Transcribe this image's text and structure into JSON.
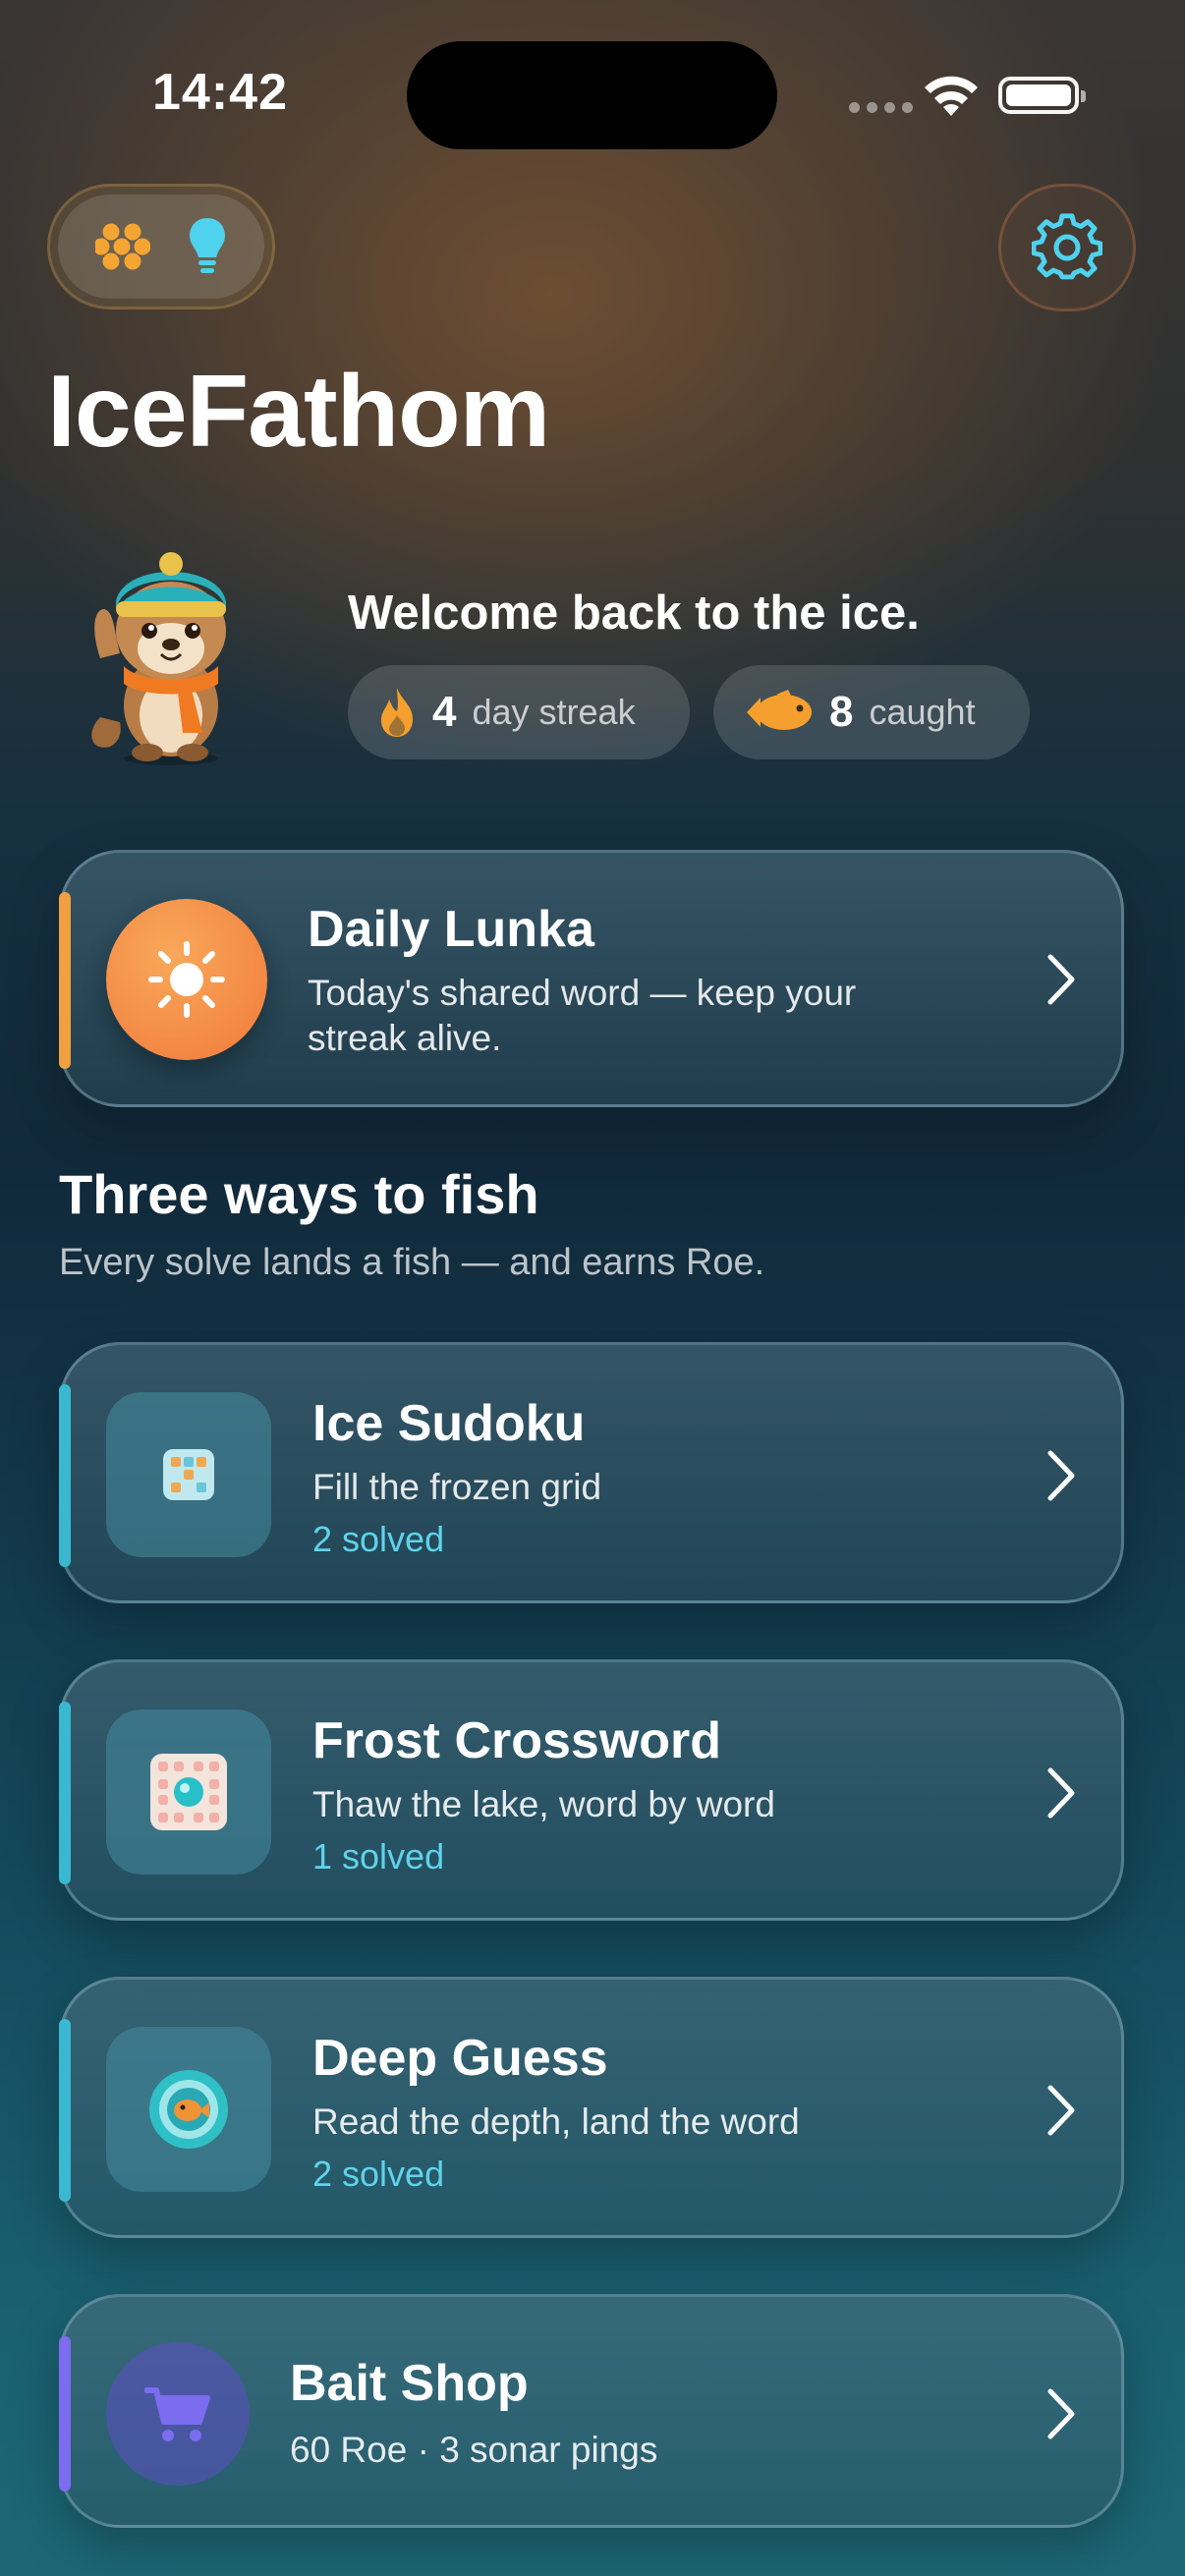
{
  "status_bar": {
    "time": "14:42"
  },
  "header": {
    "app_title": "IceFathom"
  },
  "welcome": {
    "message": "Welcome back to the ice.",
    "streak": {
      "value": "4",
      "label": "day streak"
    },
    "caught": {
      "value": "8",
      "label": "caught"
    }
  },
  "daily": {
    "title": "Daily Lunka",
    "subtitle_line1": "Today's shared word — keep your",
    "subtitle_line2": "streak alive.",
    "accent_color": "#f0a040"
  },
  "section": {
    "title": "Three ways to fish",
    "subtitle": "Every solve lands a fish — and earns Roe."
  },
  "modes": [
    {
      "title": "Ice Sudoku",
      "subtitle": "Fill the frozen grid",
      "solved": "2 solved",
      "icon": "sudoku-cube-icon"
    },
    {
      "title": "Frost Crossword",
      "subtitle": "Thaw the lake, word by word",
      "solved": "1 solved",
      "icon": "crossword-board-icon"
    },
    {
      "title": "Deep Guess",
      "subtitle": "Read the depth, land the word",
      "solved": "2 solved",
      "icon": "sonar-fish-icon"
    }
  ],
  "shop": {
    "title": "Bait Shop",
    "subtitle": "60 Roe · 3 sonar pings",
    "accent_color": "#7b6cf0"
  },
  "colors": {
    "cyan_accent": "#5fd3ea",
    "orange": "#f28a3c",
    "shop_purple": "#6b5ce0"
  }
}
